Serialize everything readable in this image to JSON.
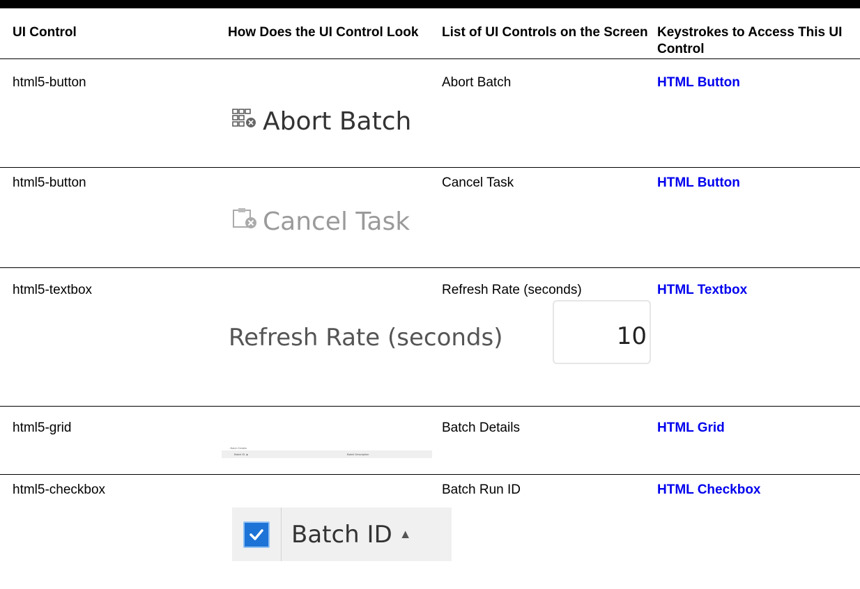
{
  "table": {
    "headers": {
      "ui_control": "UI Control",
      "look": "How Does the UI Control Look",
      "list": "List of UI Controls on the Screen",
      "keystrokes": "Keystrokes to Access This UI Control"
    },
    "rows": [
      {
        "control": "html5-button",
        "preview": {
          "label": "Abort Batch",
          "icon": "batch-abort-icon"
        },
        "list": "Abort Batch",
        "keystroke_link": "HTML Button"
      },
      {
        "control": "html5-button",
        "preview": {
          "label": "Cancel Task",
          "icon": "clipboard-cancel-icon"
        },
        "list": "Cancel Task",
        "keystroke_link": "HTML Button"
      },
      {
        "control": "html5-textbox",
        "preview": {
          "label": "Refresh Rate (seconds)",
          "value": "10"
        },
        "list": "Refresh Rate (seconds)",
        "keystroke_link": "HTML Textbox"
      },
      {
        "control": "html5-grid",
        "preview": {
          "title": "- Batch Details",
          "col1": "Batch ID ▲",
          "col2": "Batch Description"
        },
        "list": "Batch Details",
        "keystroke_link": "HTML Grid"
      },
      {
        "control": "html5-checkbox",
        "preview": {
          "label": "Batch ID",
          "arrow": "▲",
          "checked": true
        },
        "list": "Batch Run ID",
        "keystroke_link": "HTML Checkbox"
      }
    ]
  },
  "colors": {
    "link": "#0000ee",
    "checkbox_fill": "#1e73d6",
    "rule": "#000000"
  }
}
